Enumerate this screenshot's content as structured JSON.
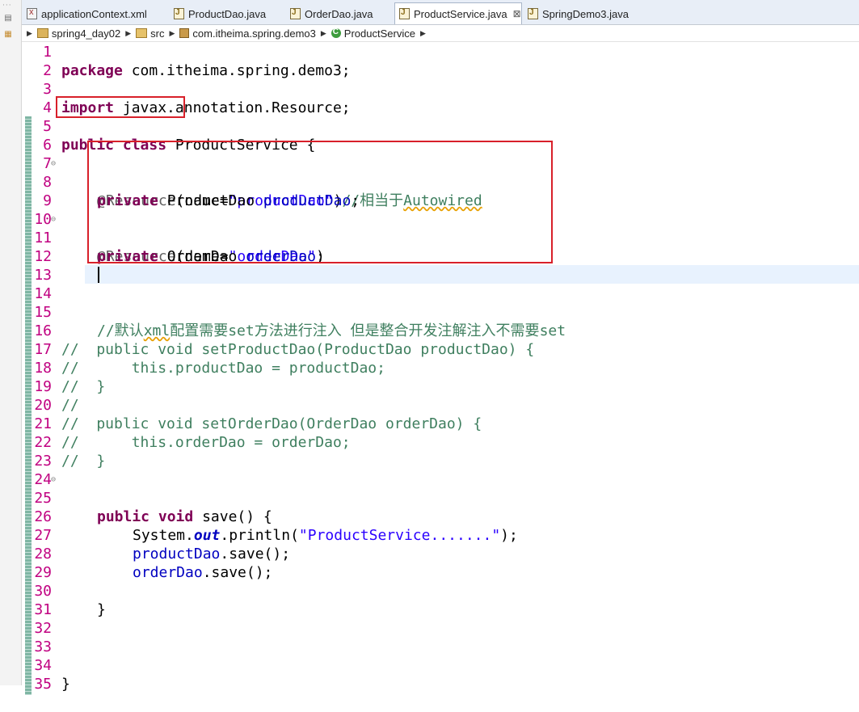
{
  "tabs": [
    {
      "label": "applicationContext.xml",
      "icon": "xml-file-icon"
    },
    {
      "label": "ProductDao.java",
      "icon": "java-file-icon"
    },
    {
      "label": "OrderDao.java",
      "icon": "java-file-icon"
    },
    {
      "label": "ProductService.java",
      "icon": "java-file-icon",
      "active": true,
      "close": "⊠"
    },
    {
      "label": "SpringDemo3.java",
      "icon": "java-file-icon"
    }
  ],
  "breadcrumb": {
    "project": "spring4_day02",
    "folder": "src",
    "package": "com.itheima.spring.demo3",
    "class": "ProductService"
  },
  "colors": {
    "line_numbers": "#c00080",
    "keyword": "#7f0055",
    "string": "#2a00ff",
    "comment": "#3f7f5f",
    "annotation": "#646464",
    "field": "#0000c0",
    "highlight_box": "#d8202a"
  },
  "code_lines": [
    {
      "n": "1"
    },
    {
      "n": "2"
    },
    {
      "n": "3"
    },
    {
      "n": "4"
    },
    {
      "n": "5"
    },
    {
      "n": "6"
    },
    {
      "n": "7"
    },
    {
      "n": "8"
    },
    {
      "n": "9"
    },
    {
      "n": "10"
    },
    {
      "n": "11"
    },
    {
      "n": "12"
    },
    {
      "n": "13"
    },
    {
      "n": "14"
    },
    {
      "n": "15"
    },
    {
      "n": "16"
    },
    {
      "n": "17"
    },
    {
      "n": "18"
    },
    {
      "n": "19"
    },
    {
      "n": "20"
    },
    {
      "n": "21"
    },
    {
      "n": "22"
    },
    {
      "n": "23"
    },
    {
      "n": "24"
    },
    {
      "n": "25"
    },
    {
      "n": "26"
    },
    {
      "n": "27"
    },
    {
      "n": "28"
    },
    {
      "n": "29"
    },
    {
      "n": "30"
    },
    {
      "n": "31"
    },
    {
      "n": "32"
    },
    {
      "n": "33"
    },
    {
      "n": "34"
    },
    {
      "n": "35"
    }
  ],
  "code": {
    "l1": {
      "kw": "package",
      "rest": " com.itheima.spring.demo3;"
    },
    "l3": {
      "kw": "import",
      "rest": " javax.annotation.Resource;"
    },
    "l5": {
      "kw1": "public",
      "kw2": "class",
      "rest": " ProductService {"
    },
    "l7": {
      "ann": "@Resource",
      "a": "(name=",
      "str": "\"productDao\"",
      "b": ")",
      "cm1": "//相当于",
      "cm2": "Autowired"
    },
    "l8": {
      "kw": "private",
      "type": " ProductDao ",
      "fld": "productDao",
      "end": ";"
    },
    "l10": {
      "ann": "@Resource",
      "a": "(name=",
      "str": "\"orderDao\"",
      "b": ")"
    },
    "l11": {
      "kw": "private",
      "type": " OrderDao ",
      "fld": "orderDao",
      "end": ";"
    },
    "l15": {
      "cm1": "//默认",
      "cm2": "xml",
      "cm3": "配置需要",
      "cm4": "set",
      "cm5": "方法进行注入 但是整合开发注解注入不需要",
      "cm6": "set"
    },
    "l16": "//  public void setProductDao(ProductDao productDao) {",
    "l17": "//      this.productDao = productDao;",
    "l18": "//  }",
    "l19": "//",
    "l20": "//  public void setOrderDao(OrderDao orderDao) {",
    "l21": "//      this.orderDao = orderDao;",
    "l22": "//  }",
    "l24": {
      "kw1": "public",
      "kw2": "void",
      "rest": " save() {"
    },
    "l26": {
      "a": "System.",
      "st": "out",
      "b": ".println(",
      "str": "\"ProductService.......\"",
      "c": ");"
    },
    "l27": {
      "fld": "productDao",
      "rest": ".save();"
    },
    "l28": {
      "fld": "orderDao",
      "rest": ".save();"
    },
    "l30": "}",
    "l34": "}"
  }
}
